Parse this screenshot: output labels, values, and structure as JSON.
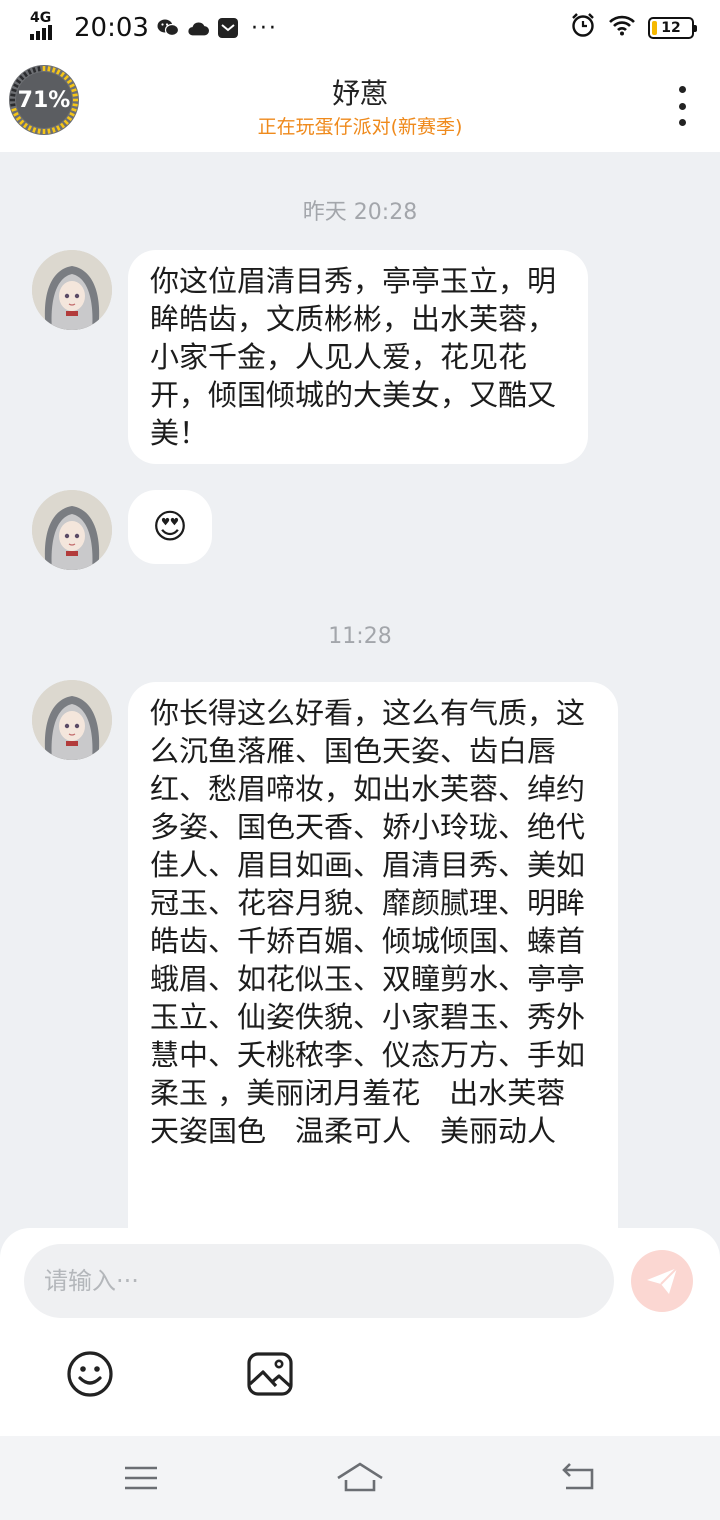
{
  "status_bar": {
    "network": "4G",
    "time": "20:03",
    "battery_level": "12",
    "battery_fraction": 0.12,
    "more_indicator": "···",
    "icons": [
      "wechat-icon",
      "cloud-icon",
      "mail-icon",
      "alarm-icon",
      "wifi-icon",
      "battery-icon"
    ]
  },
  "header": {
    "progress_label": "71%",
    "progress_value": 0.71,
    "title": "妤蒽",
    "subtitle": "正在玩蛋仔派对(新赛季)",
    "accent_color": "#ef8a1c"
  },
  "messages": {
    "ts1": "昨天 20:28",
    "msg1": "你这位眉清目秀，亭亭玉立，明眸皓齿，文质彬彬，出水芙蓉，小家千金，人见人爱，花见花开，倾国倾城的大美女，又酷又美！",
    "msg2_emoji": "😍",
    "ts2": "11:28",
    "msg3": "你长得这么好看，这么有气质，这么沉鱼落雁、国色天姿、齿白唇红、愁眉啼妆，如出水芙蓉、绰约多姿、国色天香、娇小玲珑、绝代佳人、眉目如画、眉清目秀、美如冠玉、花容月貌、靡颜腻理、明眸皓齿、千娇百媚、倾城倾国、螓首蛾眉、如花似玉、双瞳剪水、亭亭玉立、仙姿佚貌、小家碧玉、秀外慧中、夭桃秾李、仪态万方、手如柔玉 ，美丽闭月羞花　出水芙蓉　天姿国色　温柔可人　美丽动人"
  },
  "input": {
    "placeholder": "请输入···",
    "value": ""
  },
  "colors": {
    "background": "#eef0f3",
    "bubble": "#ffffff",
    "timestamp": "#a3a6ab",
    "send_button": "#fbd7d2"
  }
}
